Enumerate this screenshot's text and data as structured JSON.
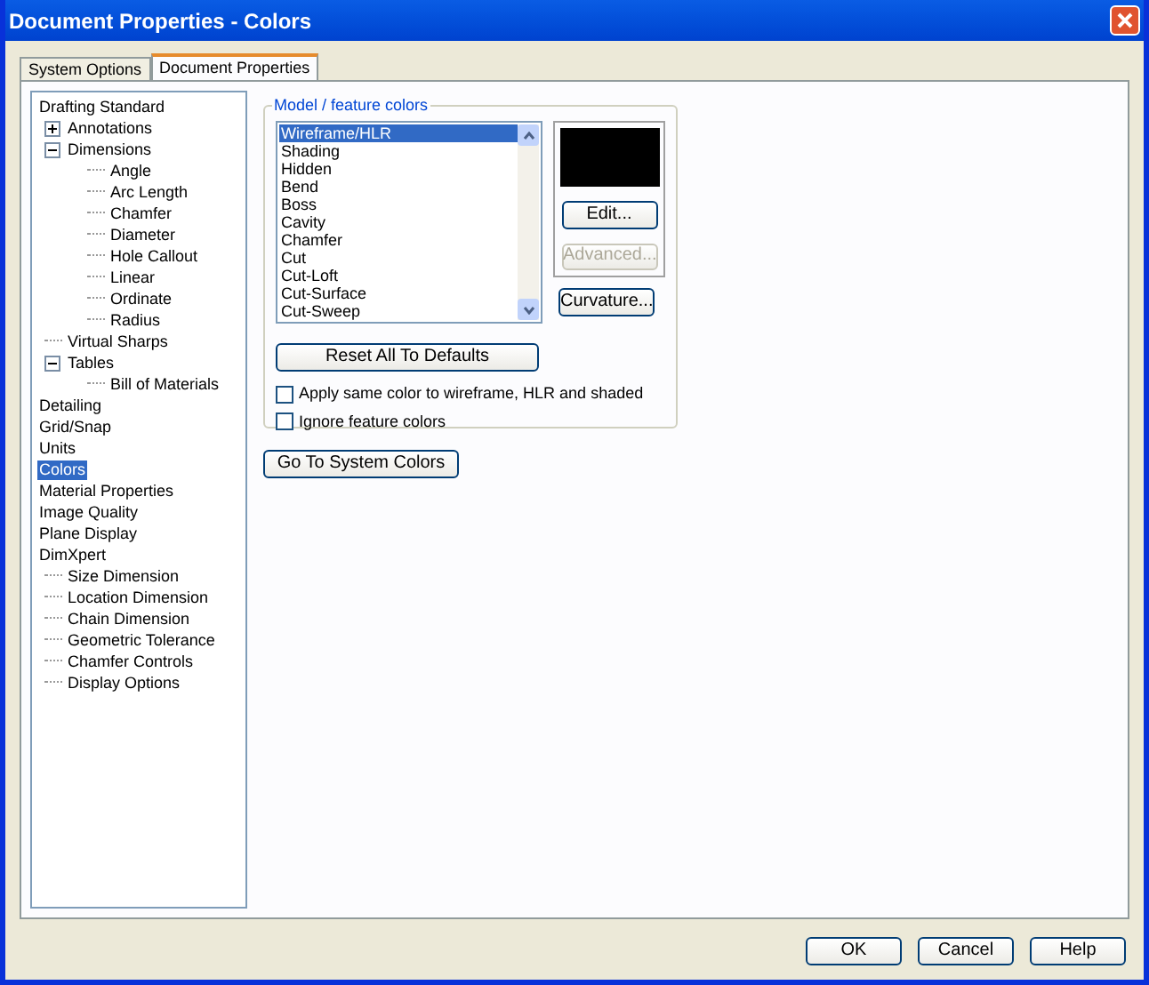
{
  "window": {
    "title": "Document Properties - Colors"
  },
  "tabs": [
    {
      "label": "System Options",
      "selected": false
    },
    {
      "label": "Document Properties",
      "selected": true
    }
  ],
  "tree": [
    {
      "label": "Drafting Standard",
      "selected": false,
      "children": [
        {
          "label": "Annotations",
          "selected": false,
          "expanded": false
        },
        {
          "label": "Dimensions",
          "selected": false,
          "expanded": true,
          "children": [
            {
              "label": "Angle",
              "selected": false
            },
            {
              "label": "Arc Length",
              "selected": false
            },
            {
              "label": "Chamfer",
              "selected": false
            },
            {
              "label": "Diameter",
              "selected": false
            },
            {
              "label": "Hole Callout",
              "selected": false
            },
            {
              "label": "Linear",
              "selected": false
            },
            {
              "label": "Ordinate",
              "selected": false
            },
            {
              "label": "Radius",
              "selected": false
            }
          ]
        },
        {
          "label": "Virtual Sharps",
          "selected": false
        },
        {
          "label": "Tables",
          "selected": false,
          "expanded": true,
          "children": [
            {
              "label": "Bill of Materials",
              "selected": false
            }
          ]
        }
      ]
    },
    {
      "label": "Detailing",
      "selected": false
    },
    {
      "label": "Grid/Snap",
      "selected": false
    },
    {
      "label": "Units",
      "selected": false
    },
    {
      "label": "Colors",
      "selected": true
    },
    {
      "label": "Material Properties",
      "selected": false
    },
    {
      "label": "Image Quality",
      "selected": false
    },
    {
      "label": "Plane Display",
      "selected": false
    },
    {
      "label": "DimXpert",
      "selected": false,
      "children": [
        {
          "label": "Size Dimension",
          "selected": false
        },
        {
          "label": "Location Dimension",
          "selected": false
        },
        {
          "label": "Chain Dimension",
          "selected": false
        },
        {
          "label": "Geometric Tolerance",
          "selected": false
        },
        {
          "label": "Chamfer Controls",
          "selected": false
        },
        {
          "label": "Display Options",
          "selected": false
        }
      ]
    }
  ],
  "group": {
    "title": "Model / feature colors",
    "list": [
      {
        "label": "Wireframe/HLR",
        "selected": true
      },
      {
        "label": "Shading",
        "selected": false
      },
      {
        "label": "Hidden",
        "selected": false
      },
      {
        "label": "Bend",
        "selected": false
      },
      {
        "label": "Boss",
        "selected": false
      },
      {
        "label": "Cavity",
        "selected": false
      },
      {
        "label": "Chamfer",
        "selected": false
      },
      {
        "label": "Cut",
        "selected": false
      },
      {
        "label": "Cut-Loft",
        "selected": false
      },
      {
        "label": "Cut-Surface",
        "selected": false
      },
      {
        "label": "Cut-Sweep",
        "selected": false
      }
    ],
    "swatch": {
      "color": "#000000"
    },
    "side_buttons": [
      {
        "label": "Edit...",
        "disabled": false
      },
      {
        "label": "Advanced...",
        "disabled": true
      }
    ],
    "curvature_button": "Curvature...",
    "reset_button": "Reset All To Defaults",
    "checkboxes": [
      {
        "label": "Apply same color to wireframe, HLR and shaded",
        "checked": false
      },
      {
        "label": "Ignore feature colors",
        "checked": false
      }
    ]
  },
  "system_colors_button": "Go To System Colors",
  "buttons": [
    "OK",
    "Cancel",
    "Help"
  ]
}
